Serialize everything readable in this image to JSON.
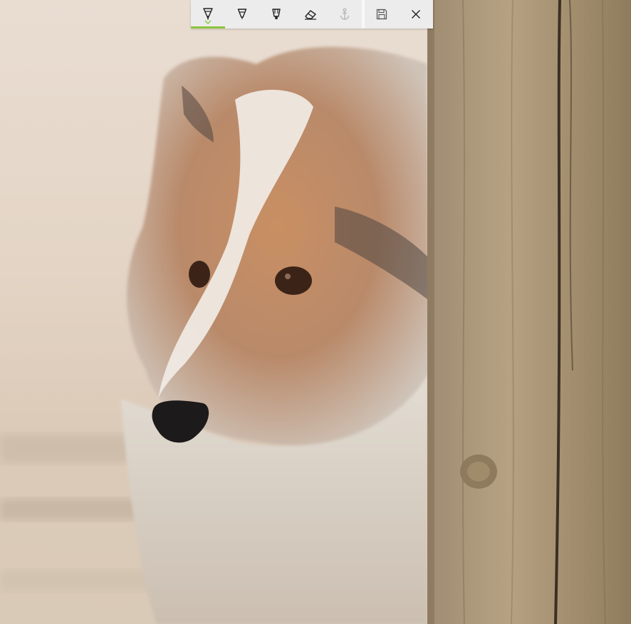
{
  "toolbar": {
    "accent_color": "#8cc63f",
    "tools": [
      {
        "name": "ballpoint-pen",
        "icon": "ballpoint-pen-icon",
        "selected": true
      },
      {
        "name": "pencil",
        "icon": "pencil-icon",
        "selected": false
      },
      {
        "name": "highlighter",
        "icon": "highlighter-icon",
        "selected": false
      },
      {
        "name": "eraser",
        "icon": "eraser-icon",
        "selected": false
      },
      {
        "name": "touch-writing",
        "icon": "anchor-icon",
        "selected": false,
        "disabled": true
      }
    ],
    "actions": [
      {
        "name": "save",
        "icon": "save-icon"
      },
      {
        "name": "close",
        "icon": "close-icon"
      }
    ]
  },
  "canvas": {
    "subject": "photo-of-sheltie-dog-beside-wooden-post",
    "icon": "photo-image"
  }
}
